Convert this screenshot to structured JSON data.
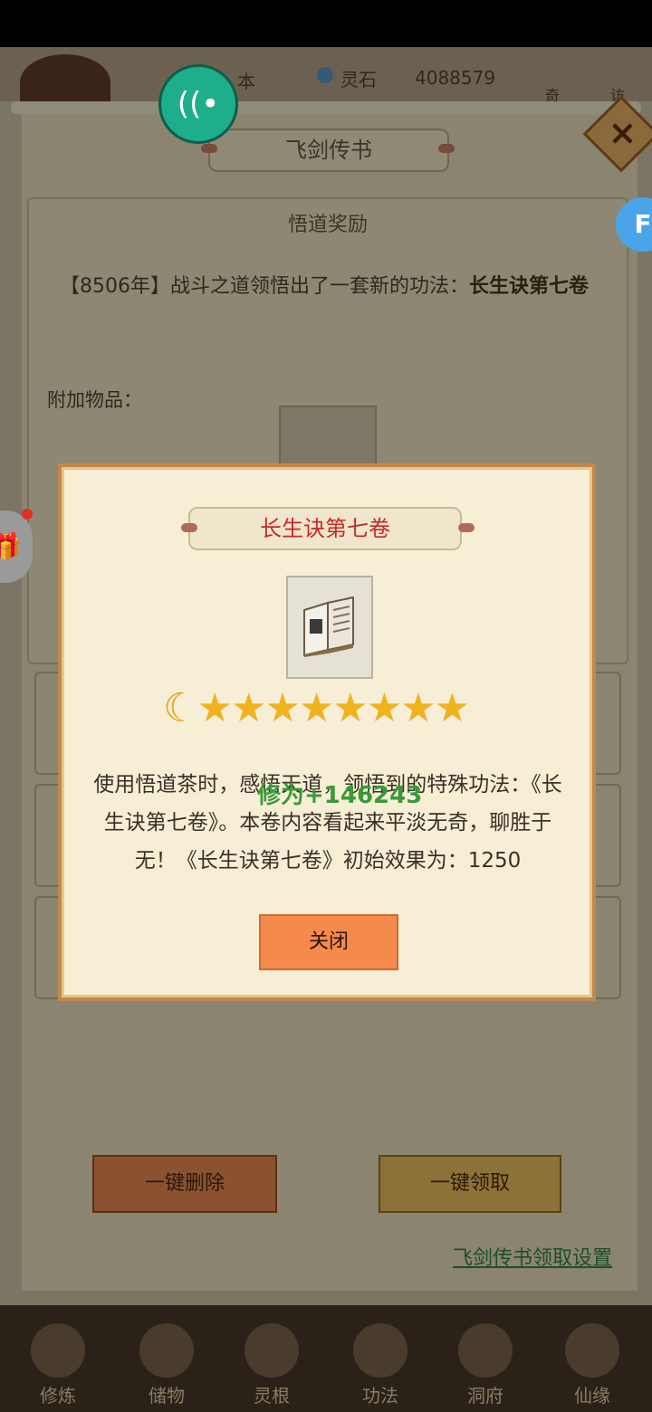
{
  "hud": {
    "res1_label": "本",
    "res2_label": "灵石",
    "res2_value": "4088579",
    "res3_label": "奇",
    "res4_label": "访"
  },
  "panel": {
    "title": "飞剑传书",
    "reward_title": "悟道奖励",
    "message_prefix": "【8506年】战斗之道领悟出了一套新的功法：",
    "message_highlight": "长生诀第七卷",
    "attachments_label": "附加物品：",
    "btn_delete_all": "一键删除",
    "btn_claim_all": "一键领取",
    "settings_link": "飞剑传书领取设置"
  },
  "modal": {
    "title": "长生诀第七卷",
    "stars_count": 8,
    "description": "使用悟道茶时，感悟天道，领悟到的特殊功法：《长生诀第七卷》。本卷内容看起来平淡无奇，聊胜于无！《长生诀第七卷》初始效果为：1250",
    "close_label": "关闭"
  },
  "floating_text": "修为+146243",
  "nav": {
    "items": [
      {
        "label": "修炼"
      },
      {
        "label": "储物"
      },
      {
        "label": "灵根"
      },
      {
        "label": "功法"
      },
      {
        "label": "洞府"
      },
      {
        "label": "仙缘"
      }
    ]
  },
  "colors": {
    "modal_bg": "#f7eed6",
    "modal_title": "#c8282a",
    "star": "#f0b21e",
    "close_button": "#f48a4c",
    "floating_text": "#3a9a3a",
    "link": "#1f4f25"
  },
  "icons": [
    "wifi-icon",
    "close-x-icon",
    "book-icon",
    "moon-icon",
    "star-icon",
    "gift-icon"
  ]
}
